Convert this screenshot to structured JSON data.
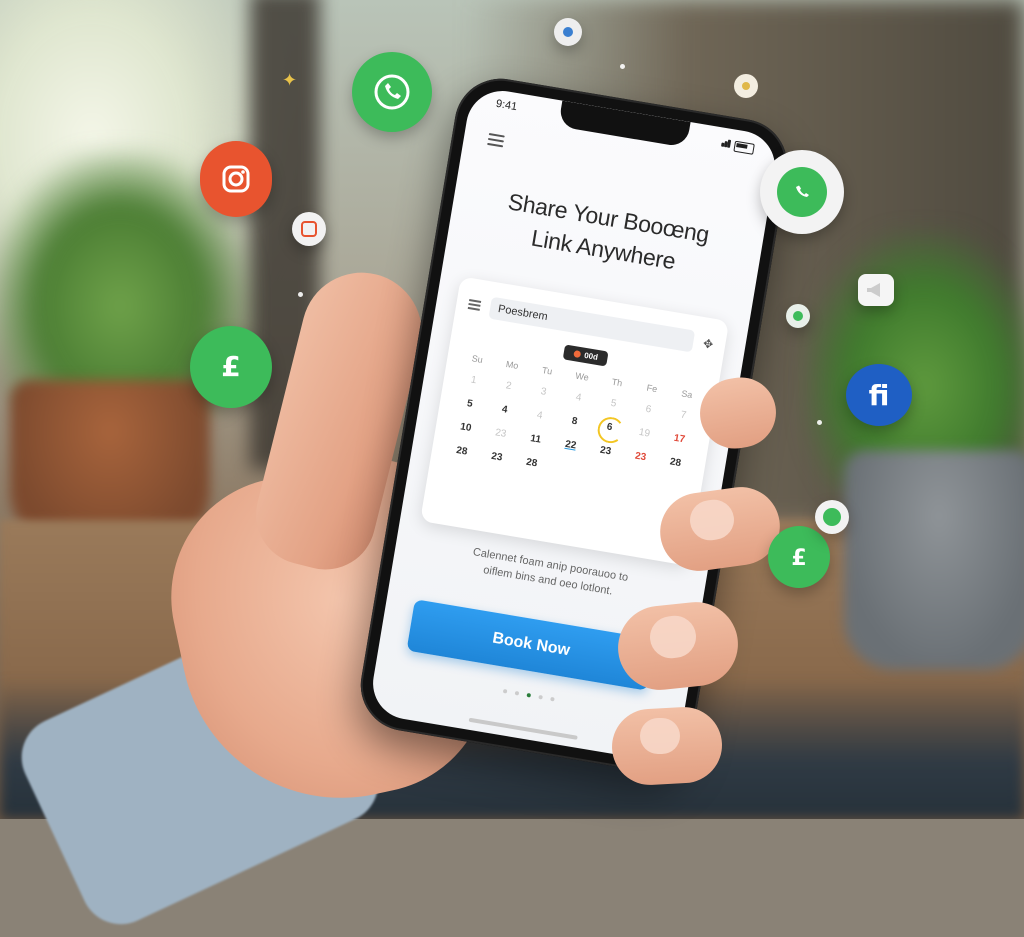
{
  "phone": {
    "headline_line1": "Share Your Booœng",
    "headline_line2": "Link Anywhere",
    "search_value": "Poesbrem",
    "month_label": "00d",
    "days_of_week": [
      "Su",
      "Mo",
      "Tu",
      "We",
      "Th",
      "Fe",
      "Sa"
    ],
    "weeks": [
      [
        "1",
        "2",
        "3",
        "4",
        "5",
        "6",
        "7"
      ],
      [
        "5",
        "4",
        "4",
        "8",
        "6",
        "19",
        "17"
      ],
      [
        "10",
        "23",
        "11",
        "22",
        "23",
        "23",
        "28"
      ],
      [
        "28",
        "23",
        "28",
        "",
        "",
        "",
        ""
      ]
    ],
    "description_line1": "Calennet foam anip poorauoo to",
    "description_line2": "oiflem bins and oeo lotlont.",
    "book_button": "Book Now"
  },
  "icons": [
    "whatsapp-icon",
    "instagram-icon",
    "pound-chat-icon",
    "whatsapp-chat-icon",
    "facebook-chat-icon",
    "megaphone-icon"
  ],
  "colors": {
    "whatsapp_green": "#3dbb5a",
    "instagram_orange": "#e8542f",
    "facebook_blue": "#1f5fc4",
    "button_blue": "#2a92e6"
  }
}
